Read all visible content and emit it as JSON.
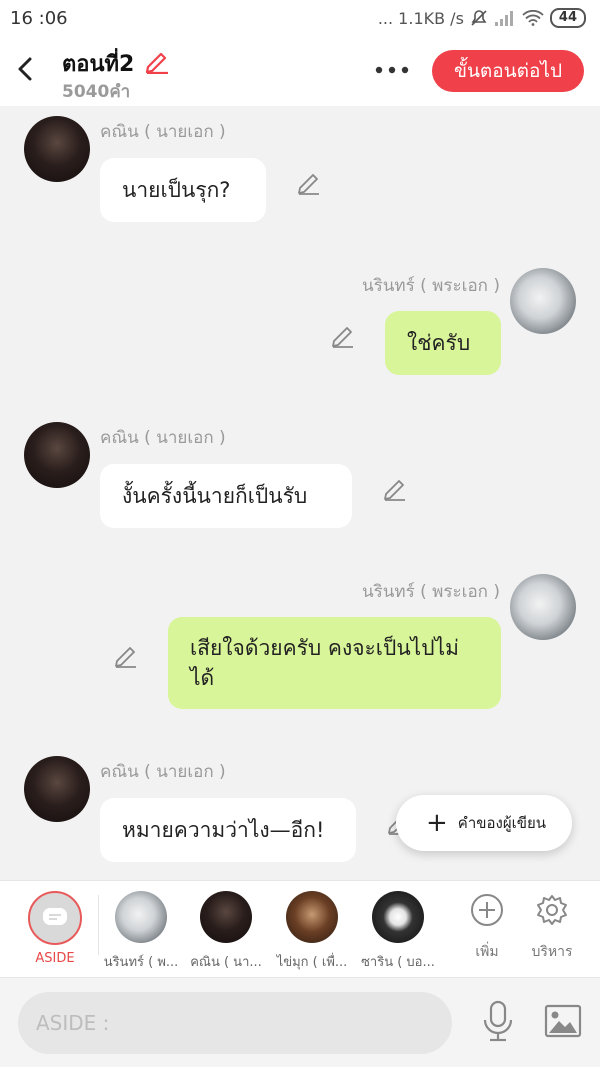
{
  "status_bar": {
    "time": "16 :06",
    "network": "... 1.1KB /s",
    "battery": "44"
  },
  "header": {
    "title": "ตอนที่2",
    "word_count": "5040คำ",
    "next_button": "ขั้นตอนต่อไป"
  },
  "messages": [
    {
      "sender": "คณิน ( นายเอก )",
      "text": "นายเป็นรุก?",
      "side": "left"
    },
    {
      "sender": "นรินทร์ ( พระเอก )",
      "text": "ใช่ครับ",
      "side": "right"
    },
    {
      "sender": "คณิน ( นายเอก )",
      "text": "งั้นครั้งนี้นายก็เป็นรับ",
      "side": "left"
    },
    {
      "sender": "นรินทร์ ( พระเอก )",
      "text": "เสียใจด้วยครับ คงจะเป็นไปไม่ได้",
      "side": "right"
    },
    {
      "sender": "คณิน ( นายเอก )",
      "text": "หมายความว่าไง—อีก!",
      "side": "left"
    }
  ],
  "fab_label": "คำของผู้เขียน",
  "character_bar": {
    "aside_label": "ASIDE",
    "characters": [
      {
        "name": "นรินทร์ ( พ..."
      },
      {
        "name": "คณิน ( นา..."
      },
      {
        "name": "ไข่มุก ( เพื่..."
      },
      {
        "name": "ซาริน ( บอ..."
      }
    ],
    "add_label": "เพิ่ม",
    "manage_label": "บริหาร"
  },
  "input": {
    "placeholder": "ASIDE :"
  },
  "colors": {
    "accent_red": "#f0414a",
    "bubble_right": "#d9f59a",
    "bubble_left": "#ffffff"
  }
}
